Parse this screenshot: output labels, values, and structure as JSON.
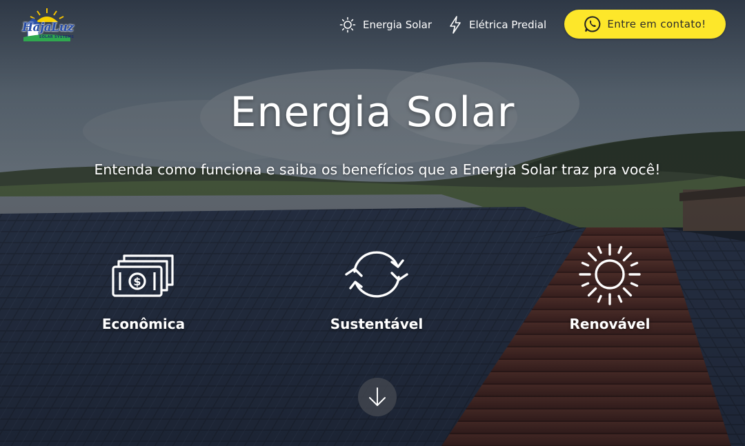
{
  "brand": {
    "name": "HajaLuz",
    "tagline": "SOLAR SYSTEMS"
  },
  "nav": {
    "items": [
      {
        "label": "Energia Solar",
        "icon": "sun-icon"
      },
      {
        "label": "Elétrica Predial",
        "icon": "lightning-icon"
      }
    ],
    "contact_label": "Entre em contato!",
    "contact_icon": "whatsapp-icon"
  },
  "hero": {
    "title": "Energia Solar",
    "subtitle": "Entenda como funciona e saiba os benefícios que a Energia Solar traz pra você!"
  },
  "features": [
    {
      "label": "Econômica",
      "icon": "money-icon"
    },
    {
      "label": "Sustentável",
      "icon": "recycle-arrows-icon"
    },
    {
      "label": "Renovável",
      "icon": "sun-icon"
    }
  ],
  "scroll": {
    "icon": "arrow-down-icon"
  },
  "colors": {
    "accent": "#fde72a",
    "text": "#ffffff",
    "brand_blue": "#2a4fa8"
  }
}
